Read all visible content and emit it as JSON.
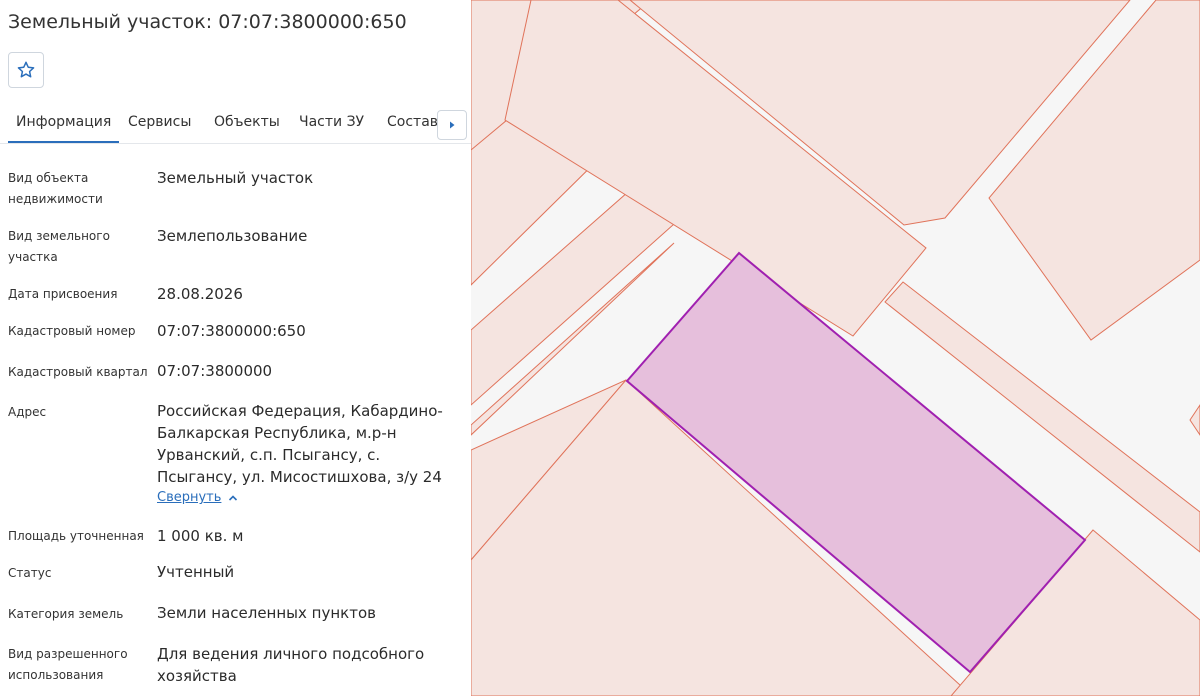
{
  "header": {
    "title": "Земельный участок: 07:07:3800000:650"
  },
  "tabs": [
    "Информация",
    "Сервисы",
    "Объекты",
    "Части ЗУ",
    "Состав"
  ],
  "details": [
    {
      "label": "Вид объекта недвижимости",
      "value": "Земельный участок"
    },
    {
      "label": "Вид земельного участка",
      "value": "Землепользование"
    },
    {
      "label": "Дата присвоения",
      "value": "28.08.2026"
    },
    {
      "label": "Кадастровый номер",
      "value": "07:07:3800000:650"
    },
    {
      "label": "Кадастровый квартал",
      "value": "07:07:3800000"
    },
    {
      "label": "Адрес",
      "value": "Российская Федерация, Кабардино-Балкарская Республика, м.р-н Урванский, с.п. Псыгансу, с. Псыгансу, ул. Мисостишхова, з/у 24"
    },
    {
      "label": "Площадь уточненная",
      "value": "1 000 кв. м"
    },
    {
      "label": "Статус",
      "value": "Учтенный"
    },
    {
      "label": "Категория земель",
      "value": "Земли населенных пунктов"
    },
    {
      "label": "Вид разрешенного использования",
      "value": "Для ведения личного подсобного хозяйства"
    }
  ],
  "address_toggle": "Свернуть",
  "colors": {
    "accent": "#2a6ebb",
    "parcel_fill": "#f5e4e0",
    "parcel_stroke": "#e0735a",
    "selected_fill": "#e6bfdc",
    "selected_stroke": "#a020b0",
    "road": "#f6f6f6"
  },
  "icons": {
    "favorite": "star-icon",
    "next": "caret-right-icon",
    "collapse": "chevron-up-icon"
  }
}
